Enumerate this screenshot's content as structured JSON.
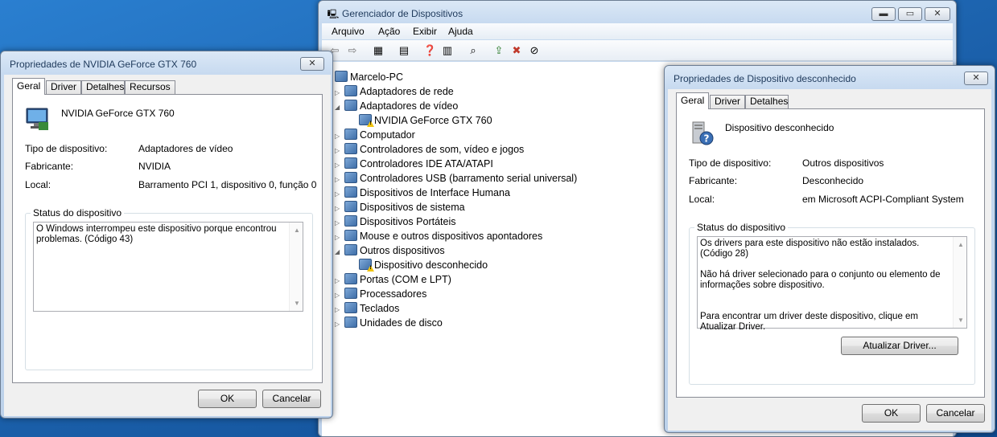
{
  "devmgr": {
    "title": "Gerenciador de Dispositivos",
    "menu": [
      "Arquivo",
      "Ação",
      "Exibir",
      "Ajuda"
    ],
    "root": "Marcelo-PC",
    "tree": [
      {
        "label": "Adaptadores de rede",
        "icon": "network-icon",
        "expanded": false
      },
      {
        "label": "Adaptadores de vídeo",
        "icon": "display-adapter-icon",
        "expanded": true
      },
      {
        "label": "NVIDIA GeForce GTX 760",
        "icon": "display-warning-icon",
        "child": true,
        "warn": true
      },
      {
        "label": "Computador",
        "icon": "computer-icon",
        "expanded": false
      },
      {
        "label": "Controladores de som, vídeo e jogos",
        "icon": "speaker-icon",
        "expanded": false
      },
      {
        "label": "Controladores IDE ATA/ATAPI",
        "icon": "ide-icon",
        "expanded": false
      },
      {
        "label": "Controladores USB (barramento serial universal)",
        "icon": "usb-icon",
        "expanded": false
      },
      {
        "label": "Dispositivos de Interface Humana",
        "icon": "hid-icon",
        "expanded": false
      },
      {
        "label": "Dispositivos de sistema",
        "icon": "system-device-icon",
        "expanded": false
      },
      {
        "label": "Dispositivos Portáteis",
        "icon": "portable-device-icon",
        "expanded": false
      },
      {
        "label": "Mouse e outros dispositivos apontadores",
        "icon": "mouse-icon",
        "expanded": false
      },
      {
        "label": "Outros dispositivos",
        "icon": "other-devices-icon",
        "expanded": true
      },
      {
        "label": "Dispositivo desconhecido",
        "icon": "unknown-device-icon",
        "child": true,
        "warn": true
      },
      {
        "label": "Portas (COM e LPT)",
        "icon": "port-icon",
        "expanded": false
      },
      {
        "label": "Processadores",
        "icon": "processor-icon",
        "expanded": false
      },
      {
        "label": "Teclados",
        "icon": "keyboard-icon",
        "expanded": false
      },
      {
        "label": "Unidades de disco",
        "icon": "disk-icon",
        "expanded": false
      }
    ]
  },
  "nvidia": {
    "title": "Propriedades de NVIDIA GeForce GTX 760",
    "tabs": [
      "Geral",
      "Driver",
      "Detalhes",
      "Recursos"
    ],
    "device_name": "NVIDIA GeForce GTX 760",
    "type_label": "Tipo de dispositivo:",
    "type_value": "Adaptadores de vídeo",
    "mfr_label": "Fabricante:",
    "mfr_value": "NVIDIA",
    "loc_label": "Local:",
    "loc_value": "Barramento PCI 1, dispositivo 0, função 0",
    "status_title": "Status do dispositivo",
    "status_text": "O Windows interrompeu este dispositivo porque encontrou problemas. (Código 43)",
    "ok": "OK",
    "cancel": "Cancelar"
  },
  "unknown": {
    "title": "Propriedades de Dispositivo desconhecido",
    "tabs": [
      "Geral",
      "Driver",
      "Detalhes"
    ],
    "device_name": "Dispositivo desconhecido",
    "type_label": "Tipo de dispositivo:",
    "type_value": "Outros dispositivos",
    "mfr_label": "Fabricante:",
    "mfr_value": "Desconhecido",
    "loc_label": "Local:",
    "loc_value": "em Microsoft ACPI-Compliant System",
    "status_title": "Status do dispositivo",
    "status_line1": "Os drivers para este dispositivo não estão instalados. (Código 28)",
    "status_line2": "Não há driver selecionado para o conjunto ou elemento de informações sobre dispositivo.",
    "status_line3": "Para encontrar um driver deste dispositivo, clique em Atualizar Driver.",
    "update_button": "Atualizar Driver...",
    "ok": "OK",
    "cancel": "Cancelar"
  }
}
